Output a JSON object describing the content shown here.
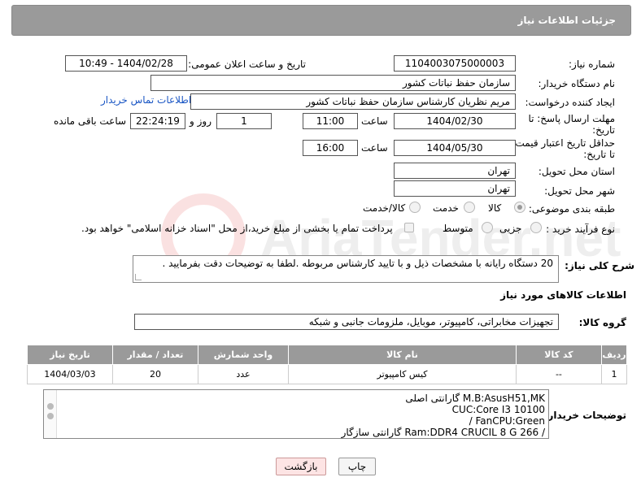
{
  "header": {
    "title": "جزئیات اطلاعات نیاز"
  },
  "fields": {
    "need_number_label": "شماره نیاز:",
    "need_number": "1104003075000003",
    "announce_label": "تاریخ و ساعت اعلان عمومی:",
    "announce_value": "1404/02/28 - 10:49",
    "buyer_org_label": "نام دستگاه خریدار:",
    "buyer_org": "سازمان حفظ نباتات کشور",
    "requester_label": "ایجاد کننده درخواست:",
    "requester": "مریم نظریان کارشناس سازمان حفظ نباتات کشور",
    "contact_link": "اطلاعات تماس خریدار",
    "deadline_label_1": "مهلت ارسال پاسخ: تا",
    "deadline_label_2": "تاریخ:",
    "deadline_date": "1404/02/30",
    "time_word": "ساعت",
    "deadline_time": "11:00",
    "days_count": "1",
    "days_word": "روز و",
    "remaining_time": "22:24:19",
    "remaining_word": "ساعت باقی مانده",
    "min_validity_label_1": "حداقل تاریخ اعتبار قیمت:",
    "min_validity_label_2": "تا تاریخ:",
    "validity_date": "1404/05/30",
    "validity_time": "16:00",
    "province_label": "استان محل تحویل:",
    "province": "تهران",
    "city_label": "شهر محل تحویل:",
    "city": "تهران",
    "category_label": "طبقه بندی موضوعی:",
    "category_options": [
      "کالا",
      "خدمت",
      "کالا/خدمت"
    ],
    "process_label": "نوع فرآیند خرید :",
    "process_options": [
      "جزیی",
      "متوسط"
    ],
    "payment_note": "پرداخت تمام یا بخشی از مبلغ خرید،از محل \"اسناد خزانه اسلامی\" خواهد بود."
  },
  "description": {
    "label": "شرح کلی نیاز:",
    "text": "20 دستگاه رایانه با مشخصات ذیل و با تایید کارشناس مربوطه .لطفا به توضیحات دقت بفرمایید ."
  },
  "goods": {
    "section_title": "اطلاعات کالاهای مورد نیاز",
    "group_label": "گروه کالا:",
    "group_value": "تجهیزات مخابراتی، کامپیوتر، موبایل، ملزومات جانبی و شبکه"
  },
  "table": {
    "headers": [
      "ردیف",
      "کد کالا",
      "نام کالا",
      "واحد شمارش",
      "تعداد / مقدار",
      "تاریخ نیاز"
    ],
    "rows": [
      [
        "1",
        "--",
        "کیس کامپیوتر",
        "عدد",
        "20",
        "1404/03/03"
      ]
    ]
  },
  "buyer_notes": {
    "label": "توضیحات خریدار:",
    "lines": [
      "M.B:AsusH51,MK گارانتی اصلی",
      "CUC:Core I3 10100",
      "FanCPU:Green /",
      "/ Ram:DDR4 CRUCIL 8 G 266 گارانتی سازگار"
    ]
  },
  "buttons": {
    "print": "چاپ",
    "back": "بازگشت"
  },
  "watermark": {
    "text": "AriaTender.net"
  },
  "colors": {
    "header_bg": "#9a9a9a",
    "link": "#1a56c4",
    "back_btn": "#fde4e4"
  }
}
